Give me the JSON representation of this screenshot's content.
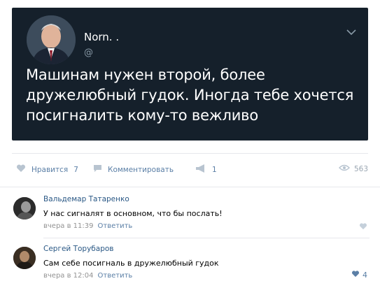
{
  "tweet": {
    "author_name": "Norn. .",
    "handle": "@",
    "text": "Машинам нужен второй, более дружелюбный гудок. Иногда тебе хочется посигналить кому-то вежливо"
  },
  "actions": {
    "like_label": "Нравится",
    "like_count": "7",
    "comment_label": "Комментировать",
    "share_count": "1",
    "views_count": "563"
  },
  "comments": [
    {
      "author": "Вальдемар Татаренко",
      "text": "У нас сигналят в основном, что бы послать!",
      "time": "вчера в 11:39",
      "reply_label": "Ответить",
      "likes": ""
    },
    {
      "author": "Сергей Торубаров",
      "text": "Сам себе посигналь в дружелюбный гудок",
      "time": "вчера в 12:04",
      "reply_label": "Ответить",
      "likes": "4"
    }
  ],
  "colors": {
    "tweet_bg": "#15202b",
    "link_blue": "#2a5885",
    "action_blue": "#5b7fa6",
    "muted_gray": "#939393"
  },
  "icons": [
    "chevron-down-icon",
    "heart-icon",
    "comment-icon",
    "megaphone-icon",
    "eye-icon"
  ]
}
